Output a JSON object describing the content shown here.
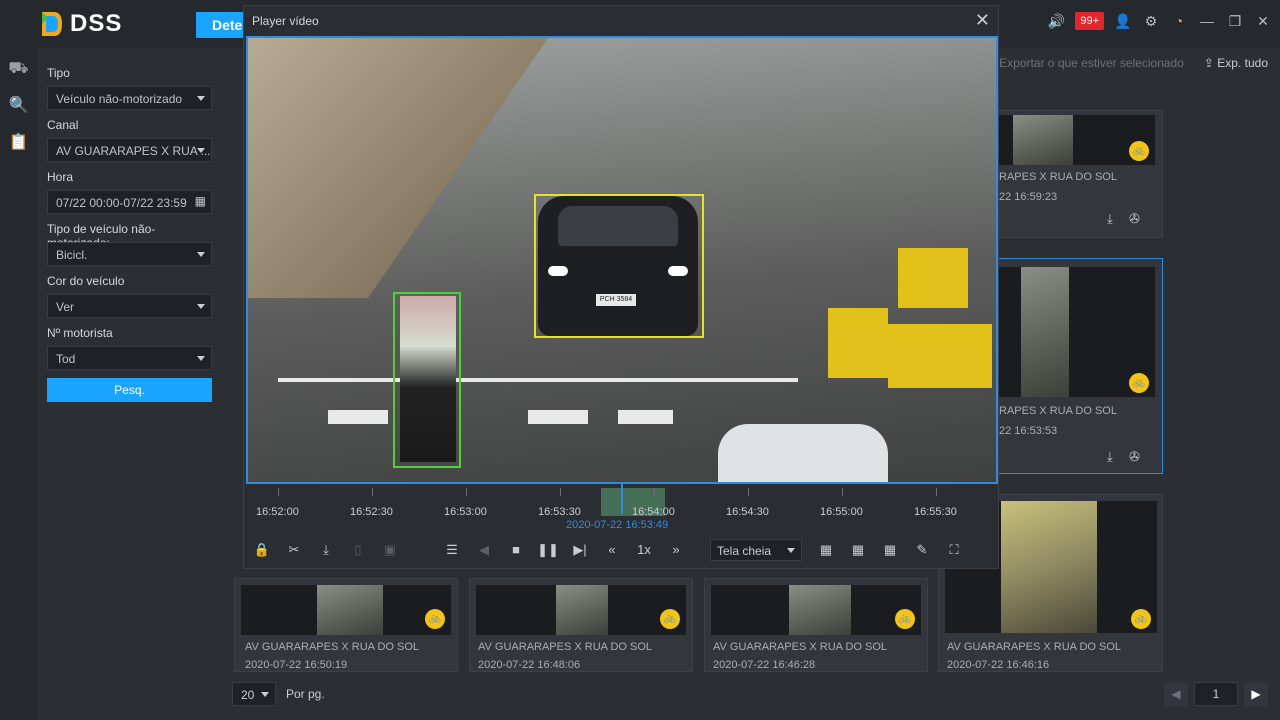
{
  "app": {
    "name": "DSS",
    "tab_label": "Dete"
  },
  "top": {
    "alarm_badge": "99+"
  },
  "filter": {
    "tipo_label": "Tipo",
    "tipo_value": "Veículo não-motorizado",
    "canal_label": "Canal",
    "canal_value": "AV GUARARAPES X RUA ...",
    "hora_label": "Hora",
    "hora_value": "07/22 00:00-07/22 23:59",
    "tipo_veiculo_label": "Tipo de veículo não-motorizado:",
    "tipo_veiculo_value": "Bicicl.",
    "cor_label": "Cor do veículo",
    "cor_value": "Ver",
    "motorista_label": "Nº motorista",
    "motorista_value": "Tod",
    "search_button": "Pesq."
  },
  "toolbar": {
    "export_selected": "Exportar o que estiver selecionado",
    "export_all": "Exp. tudo"
  },
  "player": {
    "title": "Player vídeo",
    "plate": "PCH 3584",
    "timeline_labels": [
      "16:52:00",
      "16:52:30",
      "16:53:00",
      "16:53:30",
      "16:54:00",
      "16:54:30",
      "16:55:00",
      "16:55:30"
    ],
    "current_time": "2020-07-22 16:53:49",
    "speed": "1x",
    "screen_mode": "Tela cheia"
  },
  "right_cards": [
    {
      "channel": "RAPES X RUA DO SOL",
      "time": "22 16:59:23"
    },
    {
      "channel": "RAPES X RUA DO SOL",
      "time": "22 16:53:53"
    }
  ],
  "bottom_cards": [
    {
      "channel": "AV GUARARAPES X RUA DO SOL",
      "time": "2020-07-22 16:50:19"
    },
    {
      "channel": "AV GUARARAPES X RUA DO SOL",
      "time": "2020-07-22 16:48:06"
    },
    {
      "channel": "AV GUARARAPES X RUA DO SOL",
      "time": "2020-07-22 16:46:28"
    },
    {
      "channel": "AV GUARARAPES X RUA DO SOL",
      "time": "2020-07-22 16:46:16"
    }
  ],
  "pagination": {
    "per_page": "20",
    "per_page_label": "Por pg.",
    "page": "1"
  }
}
